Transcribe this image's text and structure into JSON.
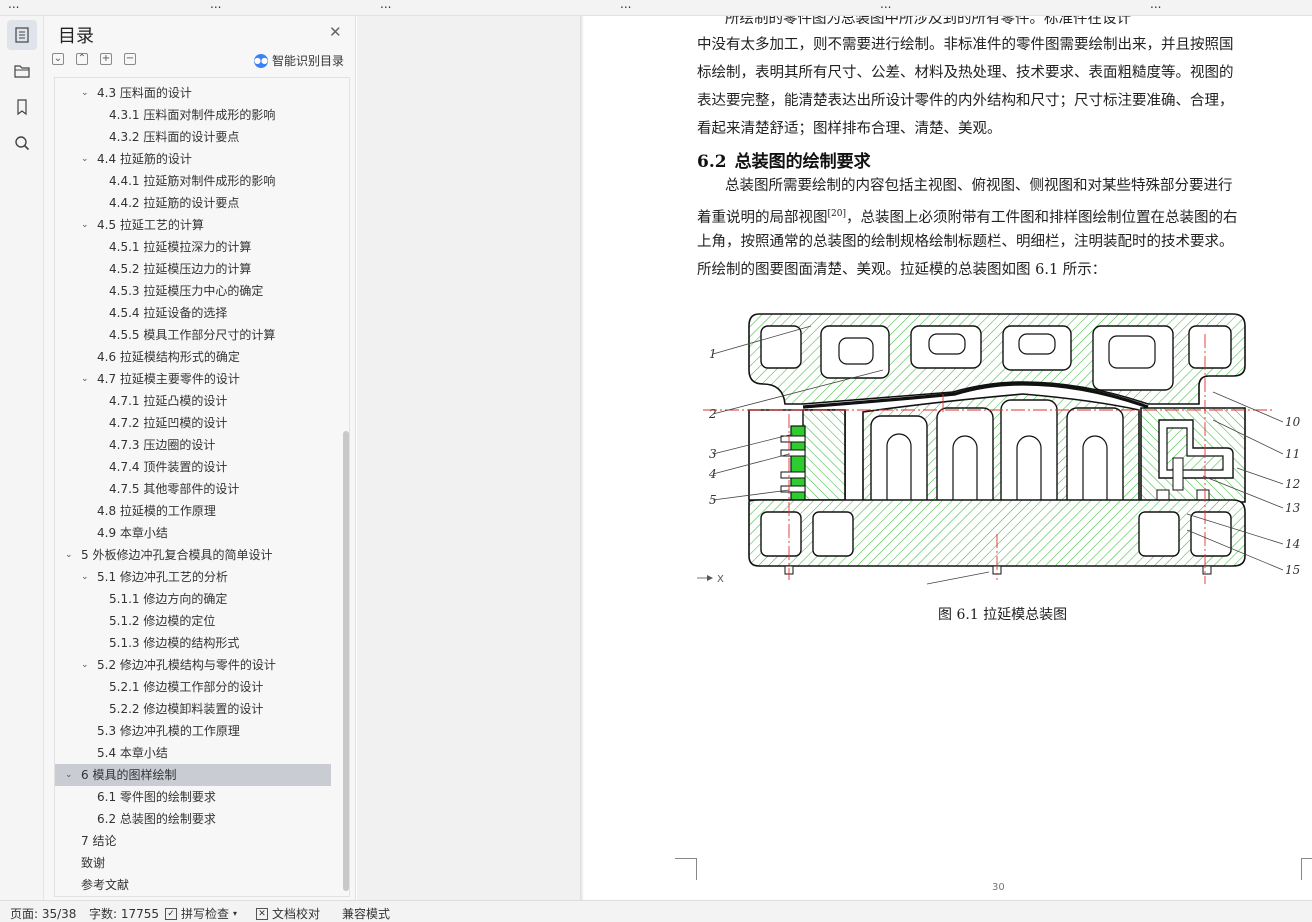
{
  "top_strip": [
    "...",
    "...",
    "...",
    "...",
    "...",
    "..."
  ],
  "toc": {
    "title": "目录",
    "smart_label": "智能识别目录",
    "items": [
      {
        "text": "4.3 压料面的设计",
        "level": 2,
        "expanded": true
      },
      {
        "text": "4.3.1 压料面对制件成形的影响",
        "level": 3
      },
      {
        "text": "4.3.2 压料面的设计要点",
        "level": 3
      },
      {
        "text": "4.4 拉延筋的设计",
        "level": 2,
        "expanded": true
      },
      {
        "text": "4.4.1 拉延筋对制件成形的影响",
        "level": 3
      },
      {
        "text": "4.4.2 拉延筋的设计要点",
        "level": 3
      },
      {
        "text": "4.5 拉延工艺的计算",
        "level": 2,
        "expanded": true
      },
      {
        "text": "4.5.1 拉延模拉深力的计算",
        "level": 3
      },
      {
        "text": "4.5.2 拉延模压边力的计算",
        "level": 3
      },
      {
        "text": "4.5.3 拉延模压力中心的确定",
        "level": 3
      },
      {
        "text": "4.5.4 拉延设备的选择",
        "level": 3
      },
      {
        "text": "4.5.5 模具工作部分尺寸的计算",
        "level": 3
      },
      {
        "text": "4.6 拉延模结构形式的确定",
        "level": 2
      },
      {
        "text": "4.7 拉延模主要零件的设计",
        "level": 2,
        "expanded": true
      },
      {
        "text": "4.7.1 拉延凸模的设计",
        "level": 3
      },
      {
        "text": "4.7.2 拉延凹模的设计",
        "level": 3
      },
      {
        "text": "4.7.3 压边圈的设计",
        "level": 3
      },
      {
        "text": "4.7.4 顶件装置的设计",
        "level": 3
      },
      {
        "text": "4.7.5 其他零部件的设计",
        "level": 3
      },
      {
        "text": "4.8 拉延模的工作原理",
        "level": 2
      },
      {
        "text": "4.9 本章小结",
        "level": 2
      },
      {
        "text": "5 外板修边冲孔复合模具的简单设计",
        "level": 1,
        "expanded": true
      },
      {
        "text": "5.1 修边冲孔工艺的分析",
        "level": 2,
        "expanded": true
      },
      {
        "text": "5.1.1 修边方向的确定",
        "level": 3
      },
      {
        "text": "5.1.2 修边模的定位",
        "level": 3
      },
      {
        "text": "5.1.3 修边模的结构形式",
        "level": 3
      },
      {
        "text": "5.2 修边冲孔模结构与零件的设计",
        "level": 2,
        "expanded": true
      },
      {
        "text": "5.2.1 修边模工作部分的设计",
        "level": 3
      },
      {
        "text": "5.2.2 修边模卸料装置的设计",
        "level": 3
      },
      {
        "text": "5.3 修边冲孔模的工作原理",
        "level": 2
      },
      {
        "text": "5.4 本章小结",
        "level": 2
      },
      {
        "text": "6 模具的图样绘制",
        "level": 1,
        "expanded": true,
        "selected": true
      },
      {
        "text": "6.1 零件图的绘制要求",
        "level": 2
      },
      {
        "text": "6.2 总装图的绘制要求",
        "level": 2
      },
      {
        "text": "7 结论",
        "level": 1
      },
      {
        "text": "致谢",
        "level": 1
      },
      {
        "text": "参考文献",
        "level": 1
      }
    ]
  },
  "doc": {
    "partial_top_line": "所绘制的零件图为总装图中所涉及到的所有零件。标准件在设计",
    "paragraph1": [
      "中没有太多加工，则不需要进行绘制。非标准件的零件图需要绘制出来，并且按照国",
      "标绘制，表明其所有尺寸、公差、材料及热处理、技术要求、表面粗糙度等。视图的",
      "表达要完整，能清楚表达出所设计零件的内外结构和尺寸；尺寸标注要准确、合理，",
      "看起来清楚舒适；图样排布合理、清楚、美观。"
    ],
    "section_number": "6.2",
    "section_title": "总装图的绘制要求",
    "paragraph2": [
      "总装图所需要绘制的内容包括主视图、俯视图、侧视图和对某些特殊部分要进行",
      "着重说明的局部视图",
      "，总装图上必须附带有工件图和排样图绘制位置在总装图的右",
      "上角，按照通常的总装图的绘制规格绘制标题栏、明细栏，注明装配时的技术要求。",
      "所绘制的图要图面清楚、美观。拉延模的总装图如图 6.1 所示："
    ],
    "citation": "[20]",
    "figure_caption": "图 6.1  拉延模总装图",
    "page_number": "30"
  },
  "drawing": {
    "left_labels": [
      "1",
      "2",
      "3",
      "4",
      "5"
    ],
    "right_labels": [
      "10",
      "11",
      "12",
      "13",
      "14",
      "15"
    ],
    "axis_mark": "X",
    "colors": {
      "hatch": "#3dbb3d",
      "solid": "#2ecc2e",
      "center_line": "#e03030"
    }
  },
  "status": {
    "page": "页面: 35/38",
    "words": "字数: 17755",
    "spell": "拼写检查",
    "proof": "文档校对",
    "compat": "兼容模式"
  }
}
